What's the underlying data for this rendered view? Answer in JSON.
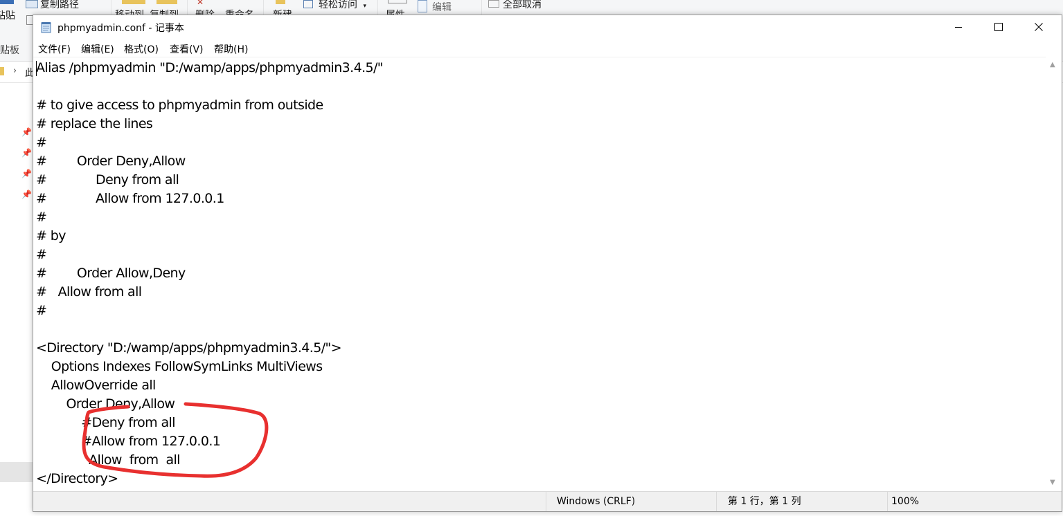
{
  "explorer": {
    "ribbon": {
      "copy_path": "复制路径",
      "paste": "粘贴",
      "clipboard": "贴板",
      "move_to": "移动到",
      "copy_to": "复制到",
      "delete": "删除",
      "rename": "重命名",
      "new": "新建",
      "easy_access": "轻松访问",
      "properties": "属性",
      "edit": "编辑",
      "select_none": "全部取消"
    },
    "address_fragment": "此"
  },
  "notepad": {
    "title": "phpmyadmin.conf - 记事本",
    "menu": [
      {
        "label": "文件(F)"
      },
      {
        "label": "编辑(E)"
      },
      {
        "label": "格式(O)"
      },
      {
        "label": "查看(V)"
      },
      {
        "label": "帮助(H)"
      }
    ],
    "content": "Alias /phpmyadmin \"D:/wamp/apps/phpmyadmin3.4.5/\"\n\n# to give access to phpmyadmin from outside \n# replace the lines\n#\n#        Order Deny,Allow\n#             Deny from all\n#             Allow from 127.0.0.1\n#\n# by\n#\n#        Order Allow,Deny \n#   Allow from all\n#\n\n<Directory \"D:/wamp/apps/phpmyadmin3.4.5/\">\n    Options Indexes FollowSymLinks MultiViews\n    AllowOverride all\n        Order Deny,Allow\n            #Deny from all\n            #Allow from 127.0.0.1\n              Allow  from  all\n</Directory>",
    "status": {
      "encoding": "Windows (CRLF)",
      "position": "第 1 行，第 1 列",
      "zoom": "100%"
    }
  },
  "colors": {
    "annotation": "#e8302f",
    "status_bar": "#f0f0f0",
    "ribbon": "#f5f6f7"
  },
  "icons": [
    "notepad-app-icon",
    "minimize-icon",
    "maximize-icon",
    "close-icon",
    "scroll-up-arrow-icon",
    "scroll-down-arrow-icon",
    "pin-icon",
    "folder-icon"
  ]
}
